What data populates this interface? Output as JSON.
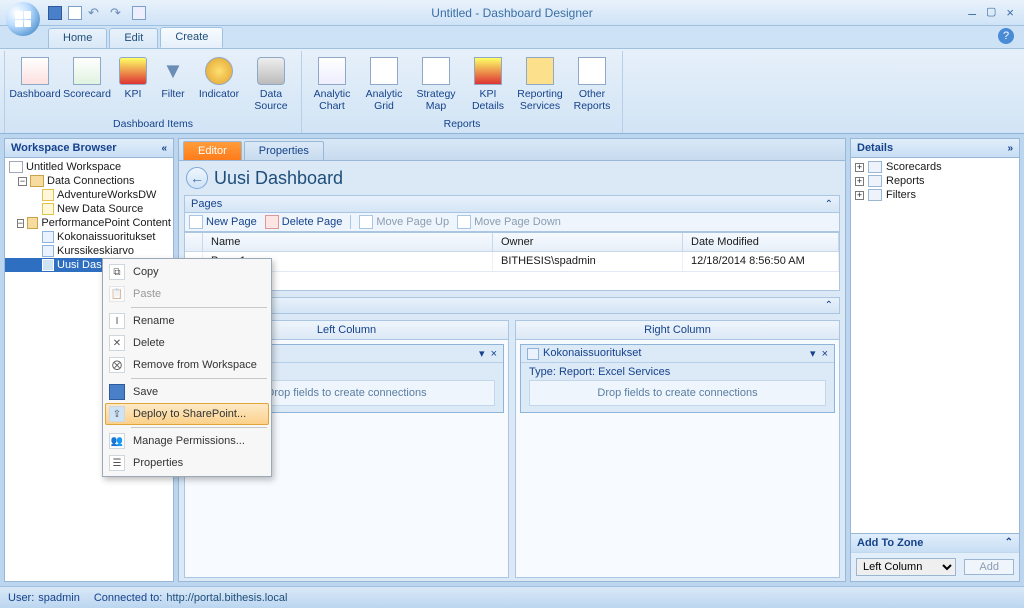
{
  "app": {
    "title": "Untitled  -  Dashboard Designer"
  },
  "tabs": {
    "home": "Home",
    "edit": "Edit",
    "create": "Create"
  },
  "ribbon": {
    "group1_label": "Dashboard Items",
    "group2_label": "Reports",
    "items1": {
      "dashboard": "Dashboard",
      "scorecard": "Scorecard",
      "kpi": "KPI",
      "filter": "Filter",
      "indicator": "Indicator",
      "datasource": "Data\nSource"
    },
    "items2": {
      "analytic_chart": "Analytic\nChart",
      "analytic_grid": "Analytic\nGrid",
      "strategy_map": "Strategy\nMap",
      "kpi_details": "KPI\nDetails",
      "reporting_services": "Reporting\nServices",
      "other_reports": "Other\nReports"
    }
  },
  "wsb": {
    "title": "Workspace Browser",
    "root": "Untitled Workspace",
    "data_conn": "Data Connections",
    "adventure": "AdventureWorksDW",
    "new_ds": "New Data Source",
    "pp_content": "PerformancePoint Content",
    "kokonais": "Kokonaissuoritukset",
    "kurssi": "Kurssikeskiarvo",
    "uusi": "Uusi Dashboard"
  },
  "editor": {
    "tab_editor": "Editor",
    "tab_properties": "Properties",
    "title": "Uusi Dashboard",
    "pages_label": "Pages",
    "toolbar": {
      "new_page": "New Page",
      "delete_page": "Delete Page",
      "move_up": "Move Page Up",
      "move_down": "Move Page Down"
    },
    "grid": {
      "col_name": "Name",
      "col_owner": "Owner",
      "col_date": "Date Modified",
      "rows": [
        {
          "name": "Page 1",
          "owner": "BITHESIS\\spadmin",
          "date": "12/18/2014 8:56:50 AM"
        }
      ]
    },
    "left_col_label": "Left Column",
    "right_col_label": "Right Column",
    "widget_left": {
      "title_blank": " ",
      "type_line": "Services",
      "drop": "Drop fields to create connections"
    },
    "widget_right": {
      "title": "Kokonaissuoritukset",
      "type_line": "Type:  Report: Excel Services",
      "drop": "Drop fields to create connections"
    }
  },
  "details": {
    "title": "Details",
    "scorecards": "Scorecards",
    "reports": "Reports",
    "filters": "Filters",
    "addzone": "Add To Zone",
    "zone_option": "Left Column",
    "add_btn": "Add"
  },
  "context_menu": {
    "copy": "Copy",
    "paste": "Paste",
    "rename": "Rename",
    "delete": "Delete",
    "remove": "Remove from Workspace",
    "save": "Save",
    "deploy": "Deploy to SharePoint...",
    "perm": "Manage Permissions...",
    "props": "Properties"
  },
  "status": {
    "user_label": "User:",
    "user": "spadmin",
    "conn_label": "Connected to:",
    "url": "http://portal.bithesis.local"
  }
}
